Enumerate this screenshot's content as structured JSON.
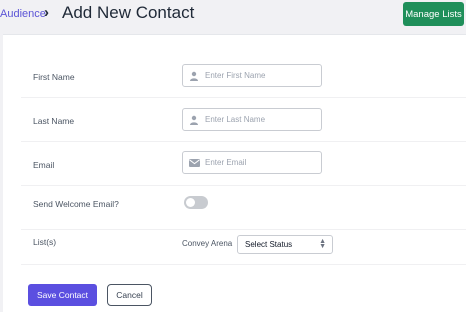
{
  "breadcrumb": {
    "parent": "Audience",
    "separator": "›"
  },
  "page_title": "Add New Contact",
  "header": {
    "manage_lists_label": "Manage Lists"
  },
  "form": {
    "first_name": {
      "label": "First Name",
      "placeholder": "Enter First Name",
      "value": "",
      "icon": "user-icon"
    },
    "last_name": {
      "label": "Last Name",
      "placeholder": "Enter Last Name",
      "value": "",
      "icon": "user-icon"
    },
    "email": {
      "label": "Email",
      "placeholder": "Enter Email",
      "value": "",
      "icon": "envelope-icon"
    },
    "welcome_email": {
      "label": "Send Welcome Email?",
      "enabled": false
    },
    "lists": {
      "label": "List(s)",
      "list_name": "Convey Arena",
      "selected": "Select Status"
    }
  },
  "actions": {
    "save_label": "Save Contact",
    "cancel_label": "Cancel"
  },
  "colors": {
    "accent": "#5b4fe0",
    "link": "#5b54d6",
    "manage_button": "#1f8f5a",
    "toggle_off": "#c8cbd0",
    "background": "#f1f1f4"
  }
}
